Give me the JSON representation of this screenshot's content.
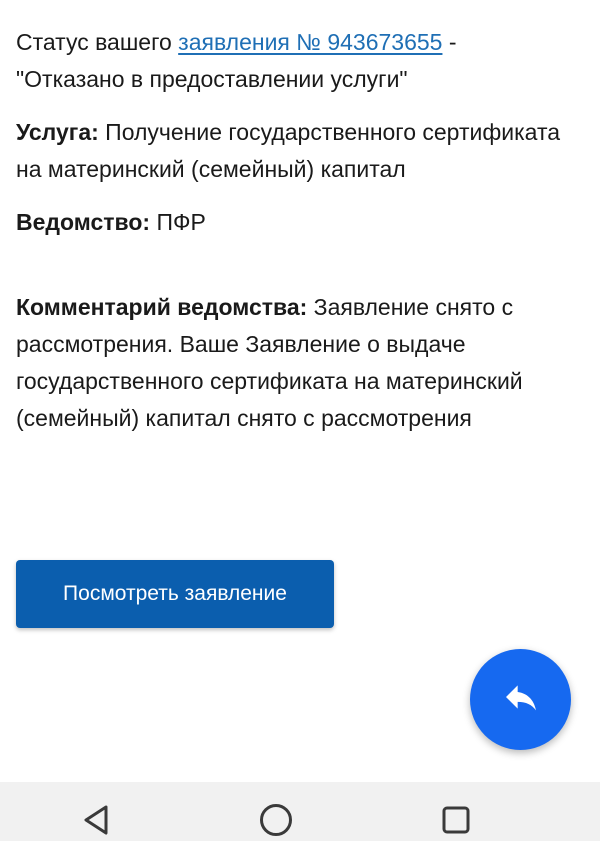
{
  "status": {
    "prefix": "Статус вашего ",
    "link_text": "заявления № 943673655",
    "separator": " -",
    "value": "\"Отказано в предоставлении услуги\""
  },
  "service": {
    "label": "Услуга:",
    "value": " Получение государственного сертификата на материнский (семейный) капитал"
  },
  "agency": {
    "label": "Ведомство:",
    "value": " ПФР"
  },
  "comment": {
    "label": "Комментарий ведомства:",
    "value": " Заявление снято с рассмотрения. Ваше Заявление о выдаче государственного сертификата на материнский (семейный) капитал снято с рассмотрения"
  },
  "actions": {
    "view_application_label": "Посмотреть заявление"
  },
  "fab": {
    "icon": "reply-icon",
    "color": "#1669f0"
  },
  "navbar": {
    "back_icon": "back-triangle-icon",
    "home_icon": "home-circle-icon",
    "recents_icon": "recents-square-icon"
  },
  "colors": {
    "link": "#1f6fb5",
    "button": "#0b5eae",
    "fab": "#1669f0",
    "navbar_bg": "#f1f1f1"
  }
}
